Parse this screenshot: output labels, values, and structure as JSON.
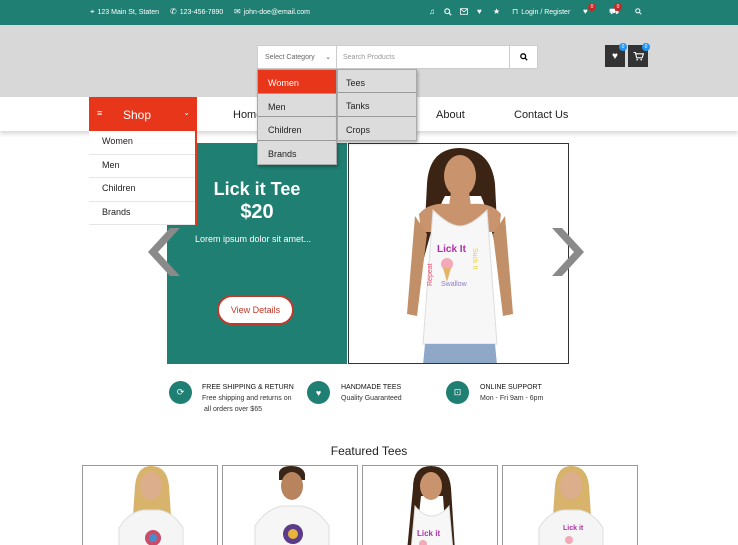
{
  "topbar": {
    "address": "123 Main St, Staten",
    "phone": "123-456-7890",
    "email": "john-doe@email.com",
    "login": "Login / Register",
    "wishlist_count": "0",
    "cart_count": "0",
    "bg_color": "#1f7f72"
  },
  "header": {
    "category_select": "Select Category",
    "search_placeholder": "Search Products",
    "wishlist_badge": "0",
    "cart_badge": "0"
  },
  "category_dropdown": {
    "options": [
      "Women",
      "Men",
      "Children",
      "Brands"
    ],
    "active": "Women",
    "sub_options": [
      "Tees",
      "Tanks",
      "Crops"
    ]
  },
  "nav": {
    "shop_label": "Shop",
    "links": [
      "Home",
      "About",
      "Contact Us"
    ],
    "shop_menu": [
      "Women",
      "Men",
      "Children",
      "Brands"
    ],
    "accent": "#e8361a"
  },
  "hero": {
    "title": "Lick it Tee",
    "price": "$20",
    "description": "Lorem ipsum dolor sit amet...",
    "button": "View Details"
  },
  "features": [
    {
      "title": "FREE SHIPPING & RETURN",
      "line1": "Free shipping and returns on",
      "line2": "all orders over $65",
      "icon": "refresh-icon"
    },
    {
      "title": "HANDMADE TEES",
      "line1": "Quality Guaranteed",
      "line2": "",
      "icon": "heart-icon"
    },
    {
      "title": "ONLINE SUPPORT",
      "line1": "Mon - Fri 9am - 6pm",
      "line2": "",
      "icon": "support-icon"
    }
  ],
  "featured": {
    "title": "Featured Tees"
  }
}
